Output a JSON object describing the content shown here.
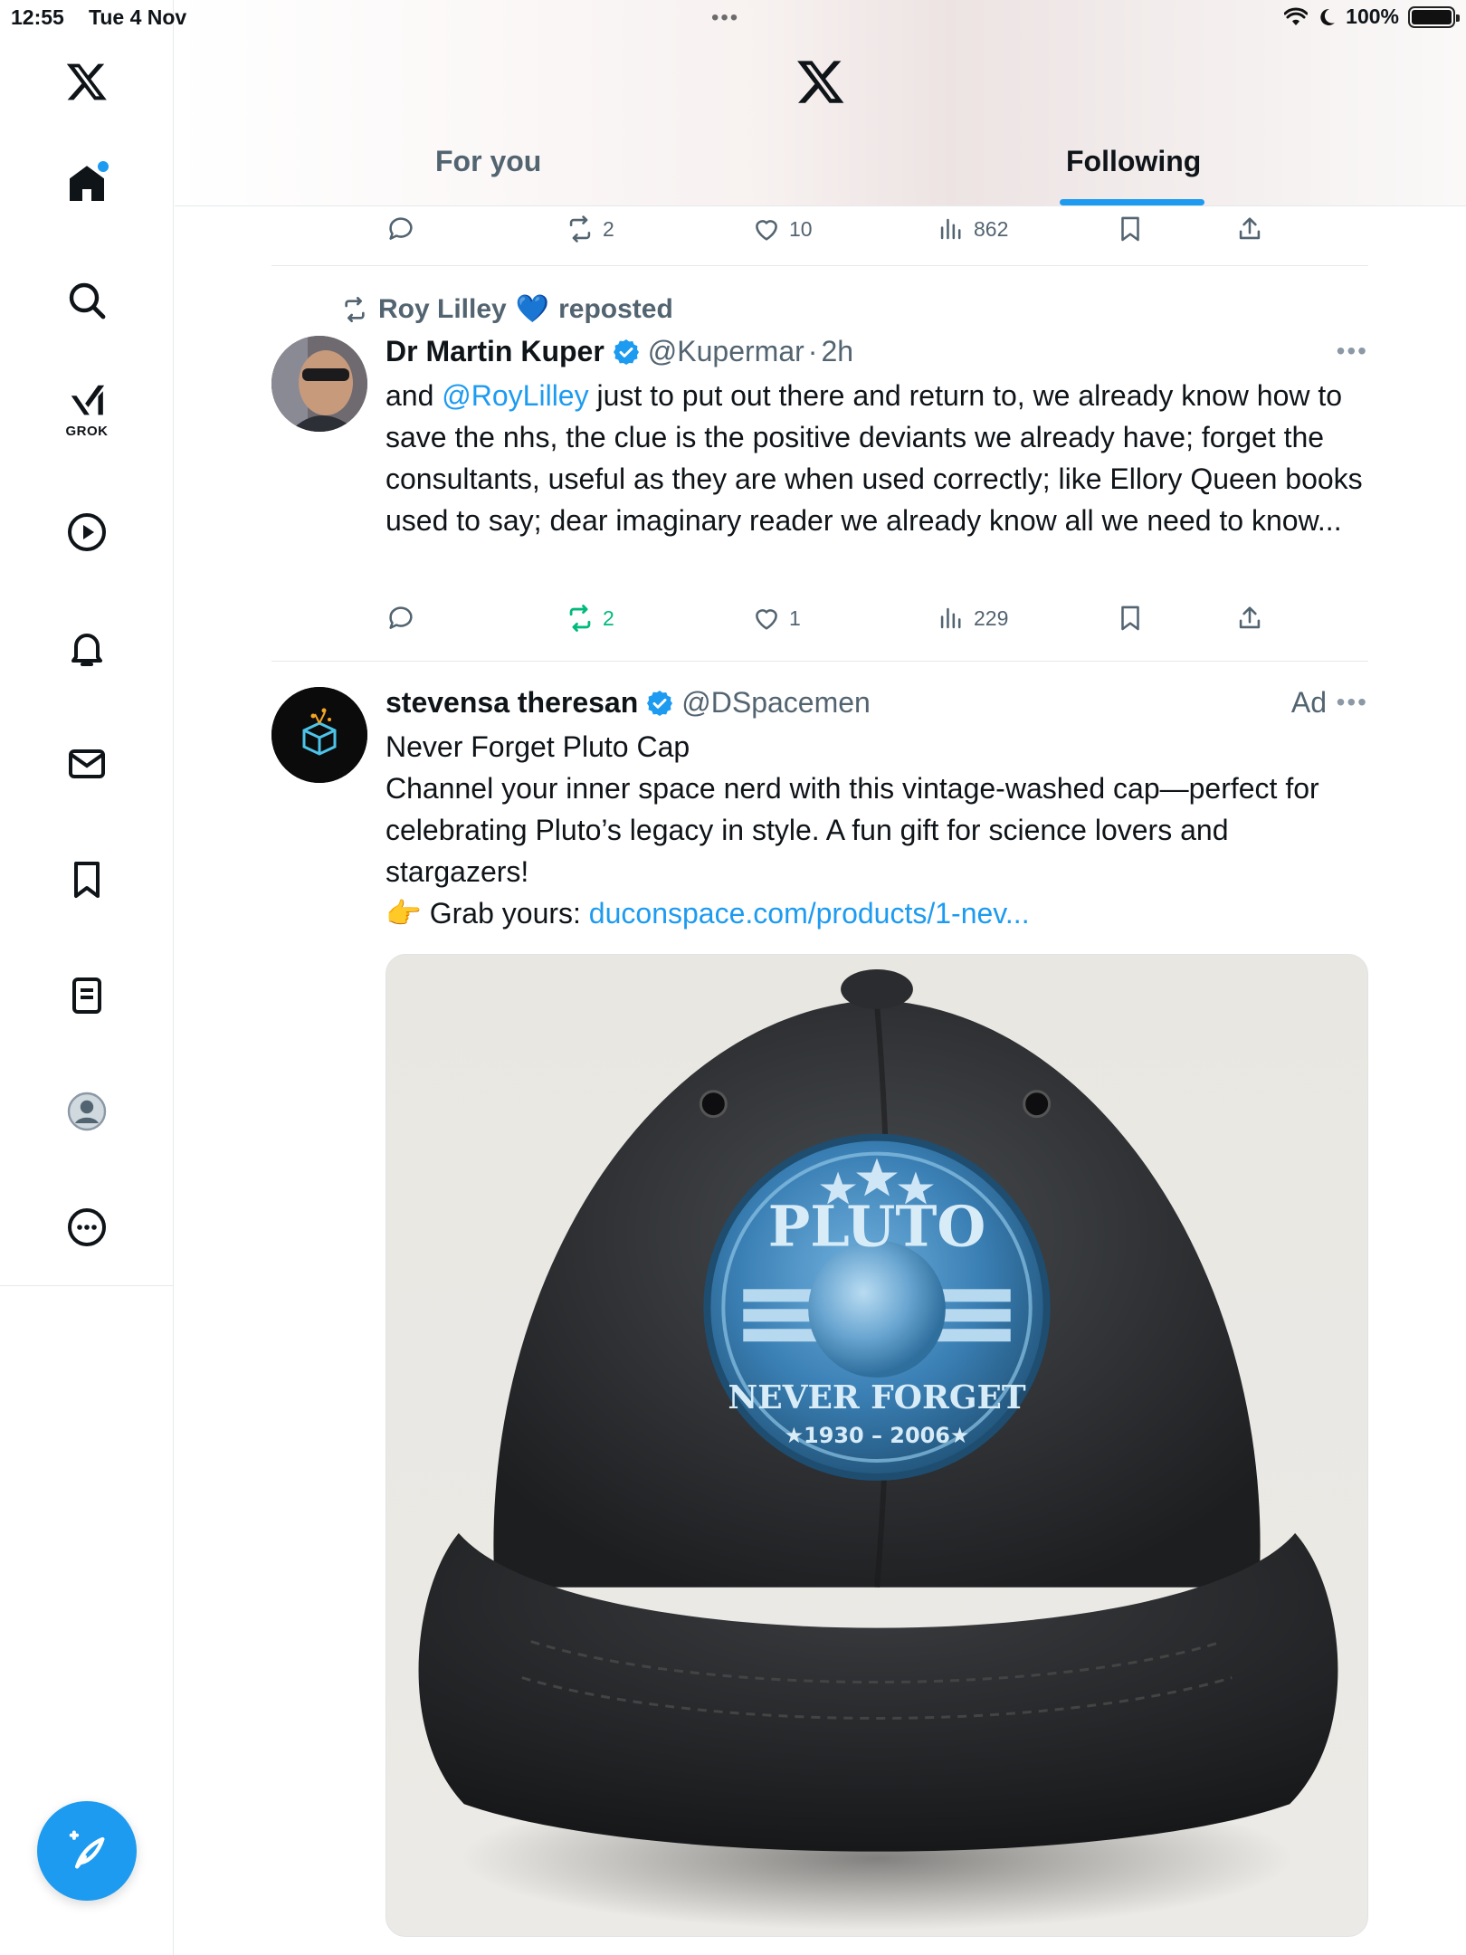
{
  "status_bar": {
    "time": "12:55",
    "date": "Tue 4 Nov",
    "battery_text": "100%"
  },
  "sidebar": {
    "items": [
      {
        "name": "x-logo",
        "icon": "x-logo"
      },
      {
        "name": "home",
        "icon": "home-icon"
      },
      {
        "name": "search",
        "icon": "search-icon"
      },
      {
        "name": "grok",
        "icon": "grok-icon",
        "label": "GROK"
      },
      {
        "name": "video",
        "icon": "play-icon"
      },
      {
        "name": "notifications",
        "icon": "bell-icon"
      },
      {
        "name": "messages",
        "icon": "mail-icon"
      },
      {
        "name": "bookmarks",
        "icon": "bookmark-icon"
      },
      {
        "name": "lists",
        "icon": "list-icon"
      },
      {
        "name": "profile",
        "icon": "avatar-icon"
      },
      {
        "name": "more",
        "icon": "more-circle-icon"
      }
    ],
    "compose_icon": "compose-icon"
  },
  "header": {
    "tabs": [
      {
        "label": "For you",
        "active": false
      },
      {
        "label": "Following",
        "active": true
      }
    ],
    "accent": "#1d9bf0"
  },
  "feed": {
    "prev_tweet_actions": {
      "replies": "",
      "reposts": "2",
      "likes": "10",
      "views": "862"
    },
    "tweet1": {
      "repost_by": "Roy Lilley",
      "repost_heart": "💙",
      "repost_suffix": "reposted",
      "name": "Dr Martin Kuper",
      "handle": "@Kupermar",
      "dot": "·",
      "time": "2h",
      "text_pre": "and ",
      "mention": "@RoyLilley",
      "text_post": " just to put out there and return to, we already know how to save the nhs, the clue is the positive deviants we already have; forget the consultants, useful as they are when used correctly; like Ellory Queen books used to say; dear imaginary reader we already know all we need to know...",
      "actions": {
        "replies": "",
        "reposts": "2",
        "likes": "1",
        "views": "229"
      }
    },
    "tweet2": {
      "name": "stevensa theresan",
      "handle": "@DSpacemen",
      "ad_label": "Ad",
      "line1": "Never Forget Pluto Cap",
      "line2": "Channel your inner space nerd with this vintage-washed cap—perfect for celebrating Pluto’s legacy in style. A fun gift for science lovers and stargazers!",
      "grab_prefix": "👉 Grab yours: ",
      "link": "duconspace.com/products/1-nev...",
      "media": {
        "badge_title": "PLUTO",
        "badge_sub": "NEVER FORGET",
        "badge_years": "★1930 – 2006★"
      }
    }
  },
  "colors": {
    "text": "#0f1419",
    "muted": "#536471",
    "green": "#00ba7c",
    "link": "#1d9bf0"
  }
}
